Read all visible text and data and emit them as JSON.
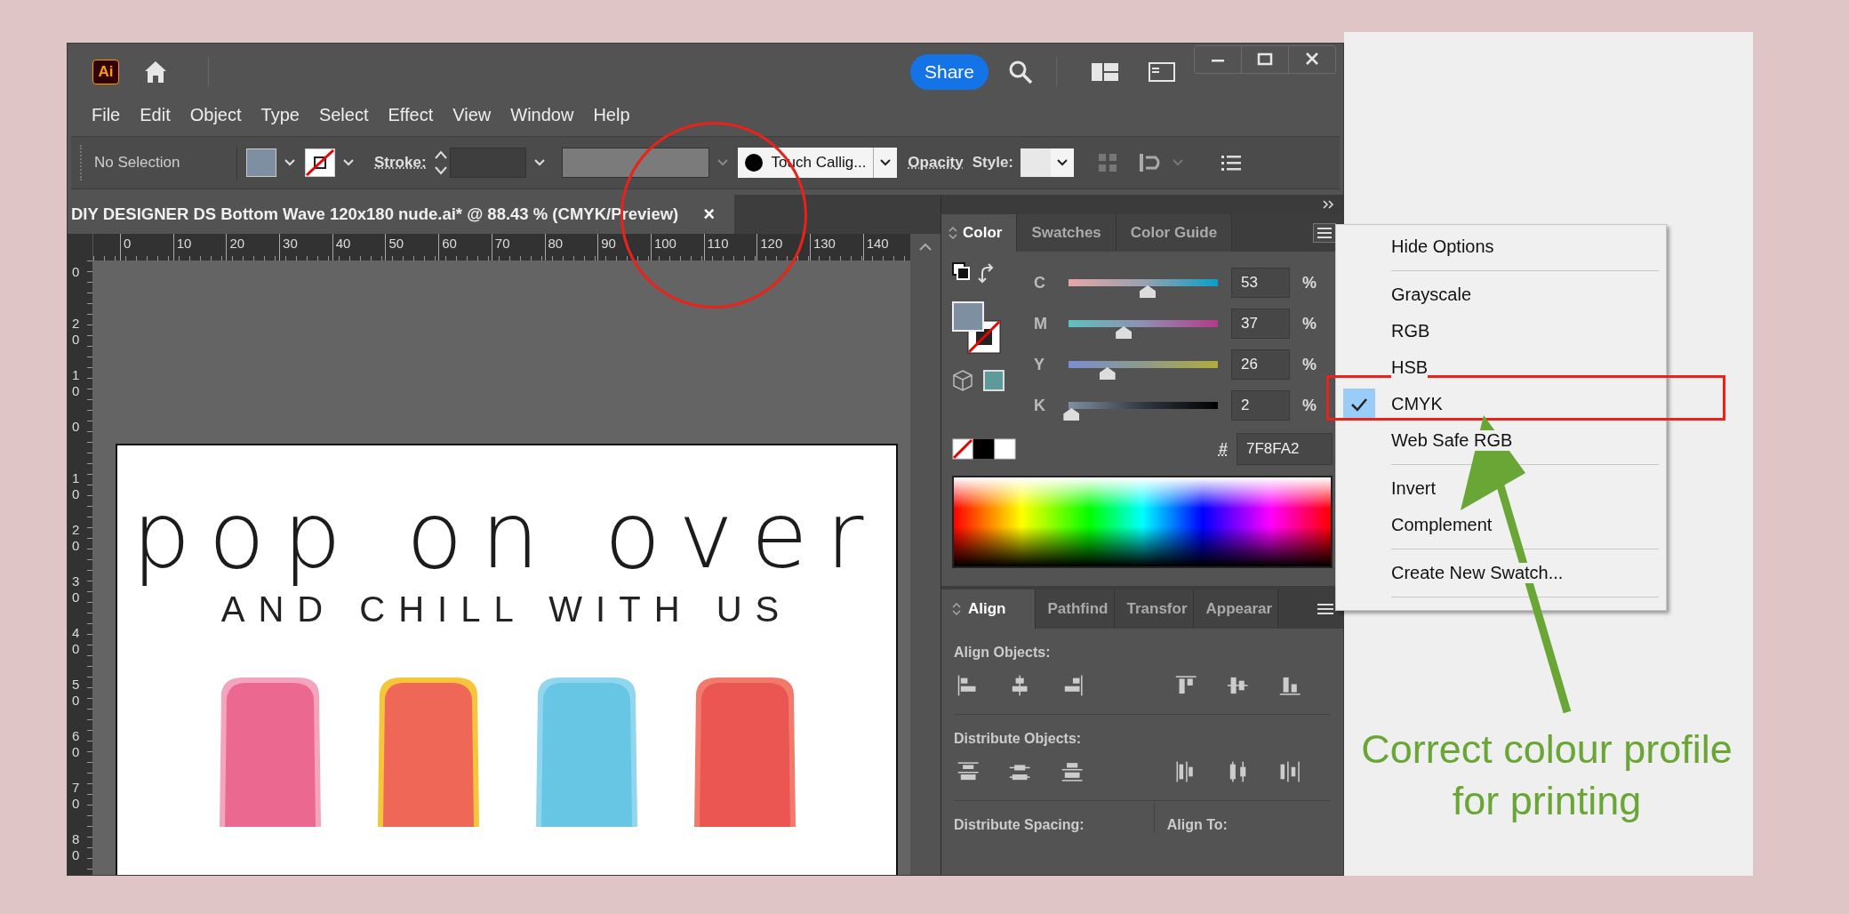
{
  "app": {
    "logo": "Ai",
    "share": "Share"
  },
  "menu_bar": [
    "File",
    "Edit",
    "Object",
    "Type",
    "Select",
    "Effect",
    "View",
    "Window",
    "Help"
  ],
  "control_bar": {
    "selection": "No Selection",
    "stroke_label": "Stroke:",
    "font": "Touch Callig...",
    "opacity_label": "Opacity",
    "style_label": "Style:"
  },
  "document_tab": {
    "title": "DIY DESIGNER DS Bottom Wave 120x180 nude.ai* @ 88.43 % (CMYK/Preview)",
    "close": "×"
  },
  "ruler": {
    "horizontal": [
      "0",
      "10",
      "20",
      "30",
      "40",
      "50",
      "60",
      "70",
      "80",
      "90",
      "100",
      "110",
      "120",
      "130",
      "140"
    ],
    "vertical": [
      "0",
      "20",
      "10",
      "0",
      "10",
      "20",
      "30",
      "40",
      "50",
      "60",
      "70",
      "80"
    ]
  },
  "artboard": {
    "headline": "pop on over",
    "subline": "AND CHILL WITH US"
  },
  "color_panel": {
    "tabs": [
      {
        "label": "Color",
        "selected": true
      },
      {
        "label": "Swatches",
        "selected": false
      },
      {
        "label": "Color Guide",
        "selected": false
      }
    ],
    "channels": [
      {
        "name": "C",
        "value": "53",
        "unit": "%",
        "level": 0.53
      },
      {
        "name": "M",
        "value": "37",
        "unit": "%",
        "level": 0.37
      },
      {
        "name": "Y",
        "value": "26",
        "unit": "%",
        "level": 0.26
      },
      {
        "name": "K",
        "value": "2",
        "unit": "%",
        "level": 0.02
      }
    ],
    "hex_label": "#",
    "hex": "7F8FA2"
  },
  "color_menu": {
    "groups": [
      {
        "items": [
          {
            "label": "Hide Options",
            "checked": false
          }
        ]
      },
      {
        "items": [
          {
            "label": "Grayscale",
            "checked": false
          },
          {
            "label": "RGB",
            "checked": false
          },
          {
            "label": "HSB",
            "checked": false
          },
          {
            "label": "CMYK",
            "checked": true
          },
          {
            "label": "Web Safe RGB",
            "checked": false
          }
        ]
      },
      {
        "items": [
          {
            "label": "Invert",
            "checked": false
          },
          {
            "label": "Complement",
            "checked": false
          }
        ]
      },
      {
        "items": [
          {
            "label": "Create New Swatch...",
            "checked": false
          }
        ]
      }
    ]
  },
  "align_panel": {
    "tabs": [
      {
        "label": "Align",
        "selected": true
      },
      {
        "label": "Pathfind",
        "selected": false
      },
      {
        "label": "Transfor",
        "selected": false
      },
      {
        "label": "Appearar",
        "selected": false
      }
    ],
    "align_objects": "Align Objects:",
    "distribute_objects": "Distribute Objects:",
    "distribute_spacing": "Distribute Spacing:",
    "align_to": "Align To:"
  },
  "annotation": {
    "caption": "Correct colour profile for printing"
  }
}
